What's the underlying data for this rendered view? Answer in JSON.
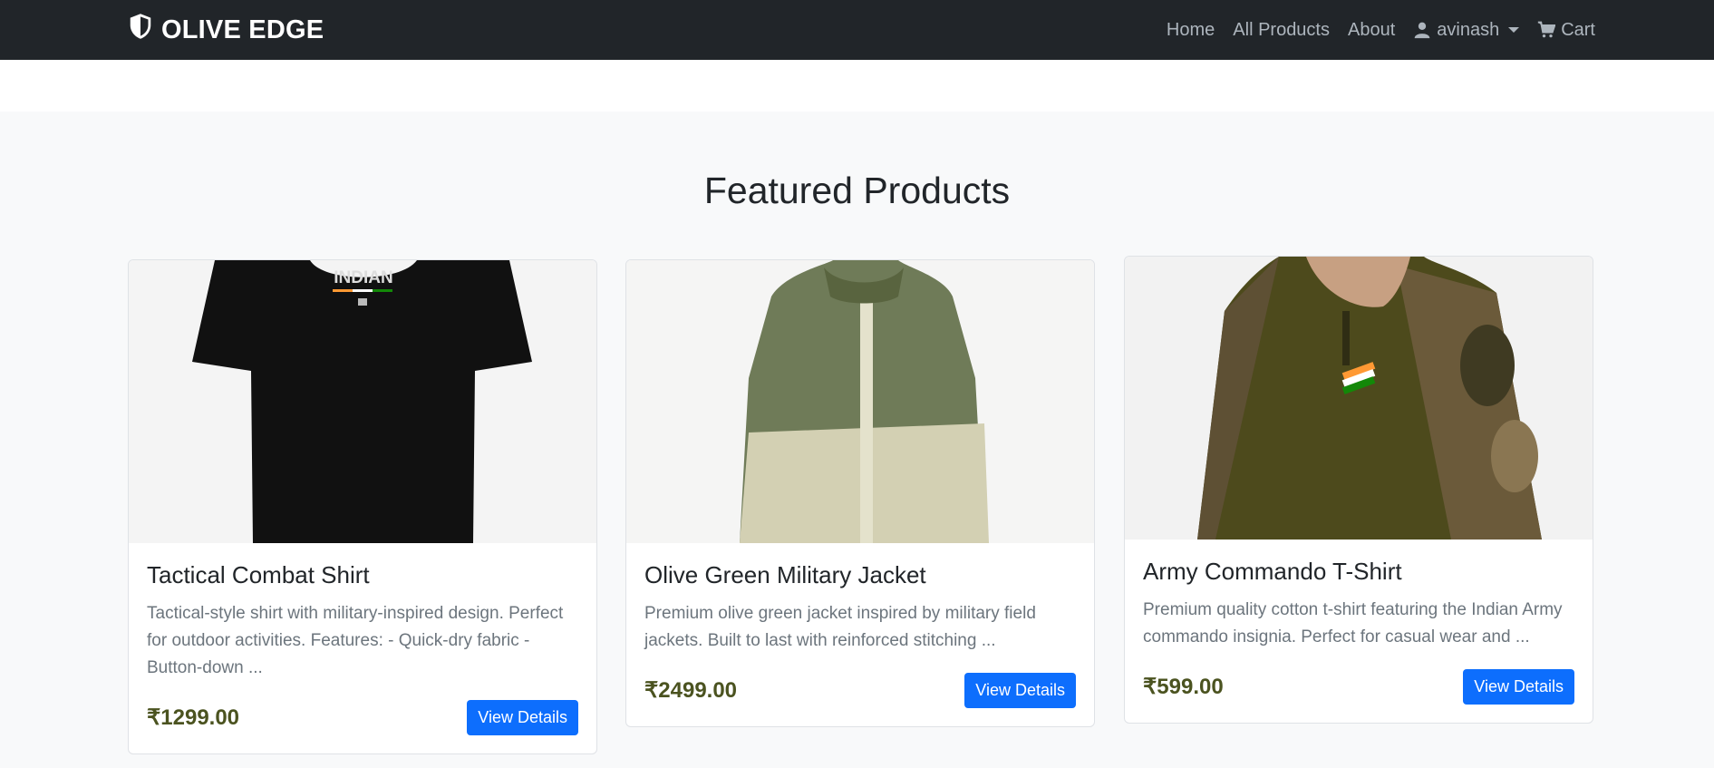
{
  "brand": {
    "name": "OLIVE EDGE"
  },
  "nav": {
    "home": "Home",
    "all_products": "All Products",
    "about": "About",
    "user": "avinash",
    "cart": "Cart"
  },
  "section": {
    "title": "Featured Products"
  },
  "products": [
    {
      "title": "Tactical Combat Shirt",
      "description": "Tactical-style shirt with military-inspired design. Perfect for outdoor activities. Features: - Quick-dry fabric - Button-down ...",
      "price": "₹1299.00",
      "button": "View Details",
      "image_text": "INDIAN"
    },
    {
      "title": "Olive Green Military Jacket",
      "description": "Premium olive green jacket inspired by military field jackets. Built to last with reinforced stitching ...",
      "price": "₹2499.00",
      "button": "View Details"
    },
    {
      "title": "Army Commando T-Shirt",
      "description": "Premium quality cotton t-shirt featuring the Indian Army commando insignia. Perfect for casual wear and ...",
      "price": "₹599.00",
      "button": "View Details"
    }
  ],
  "colors": {
    "navbar": "#212529",
    "price": "#4b5320",
    "button": "#0d6efd",
    "section_bg": "#f8f9fa"
  }
}
